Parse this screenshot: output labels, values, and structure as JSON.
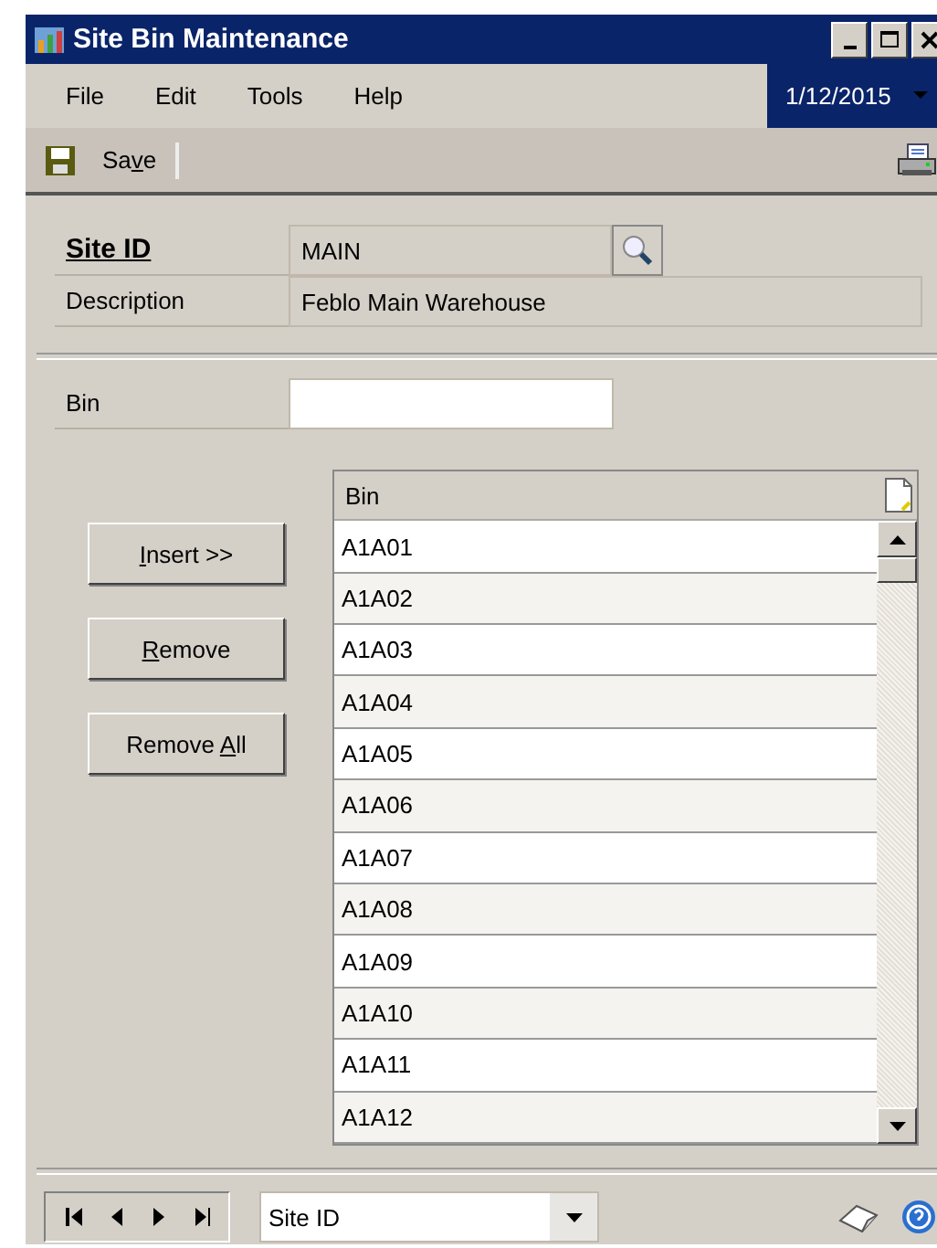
{
  "window": {
    "title": "Site Bin Maintenance"
  },
  "menu": [
    "File",
    "Edit",
    "Tools",
    "Help"
  ],
  "date": "1/12/2015",
  "toolbar": {
    "save": {
      "before": "Sa",
      "key": "v",
      "after": "e"
    }
  },
  "site": {
    "label": "Site ID",
    "value": "MAIN"
  },
  "description": {
    "label": "Description",
    "value": "Feblo Main Warehouse"
  },
  "bin_field": {
    "label": "Bin"
  },
  "buttons": [
    {
      "key": "I",
      "after": "nsert >>"
    },
    {
      "key": "R",
      "after": "emove"
    },
    {
      "before": "Remove ",
      "key": "A",
      "after": "ll"
    }
  ],
  "grid": {
    "column": "Bin",
    "rows": [
      "A1A01",
      "A1A02",
      "A1A03",
      "A1A04",
      "A1A05",
      "A1A06",
      "A1A07",
      "A1A08",
      "A1A09",
      "A1A10",
      "A1A11",
      "A1A12"
    ]
  },
  "footer": {
    "sort": "Site ID"
  }
}
